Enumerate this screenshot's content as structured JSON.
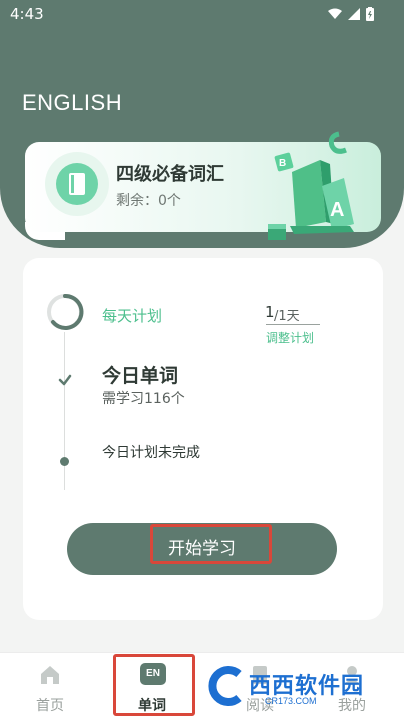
{
  "status_bar": {
    "time": "4:43"
  },
  "header": {
    "title": "ENGLISH"
  },
  "book_card": {
    "title": "四级必备词汇",
    "remaining": "剩余：0个"
  },
  "plan": {
    "daily_label": "每天计划",
    "done": "1",
    "total": "/1天",
    "adjust": "调整计划",
    "today_title": "今日单词",
    "today_need": "需学习116个",
    "status": "今日计划未完成"
  },
  "start_button": {
    "label": "开始学习"
  },
  "bottom_nav": {
    "items": [
      {
        "label": "首页",
        "icon": "home-icon",
        "active": false
      },
      {
        "label": "单词",
        "icon": "en-icon",
        "active": true
      },
      {
        "label": "阅读",
        "icon": "doc-icon",
        "active": false
      },
      {
        "label": "我的",
        "icon": "user-icon",
        "active": false
      }
    ]
  },
  "watermark": {
    "text": "西西软件园",
    "sub": "CR173.COM"
  },
  "colors": {
    "primary": "#5e7a6f",
    "accent": "#4cbf8d",
    "highlight": "#d9473a"
  }
}
